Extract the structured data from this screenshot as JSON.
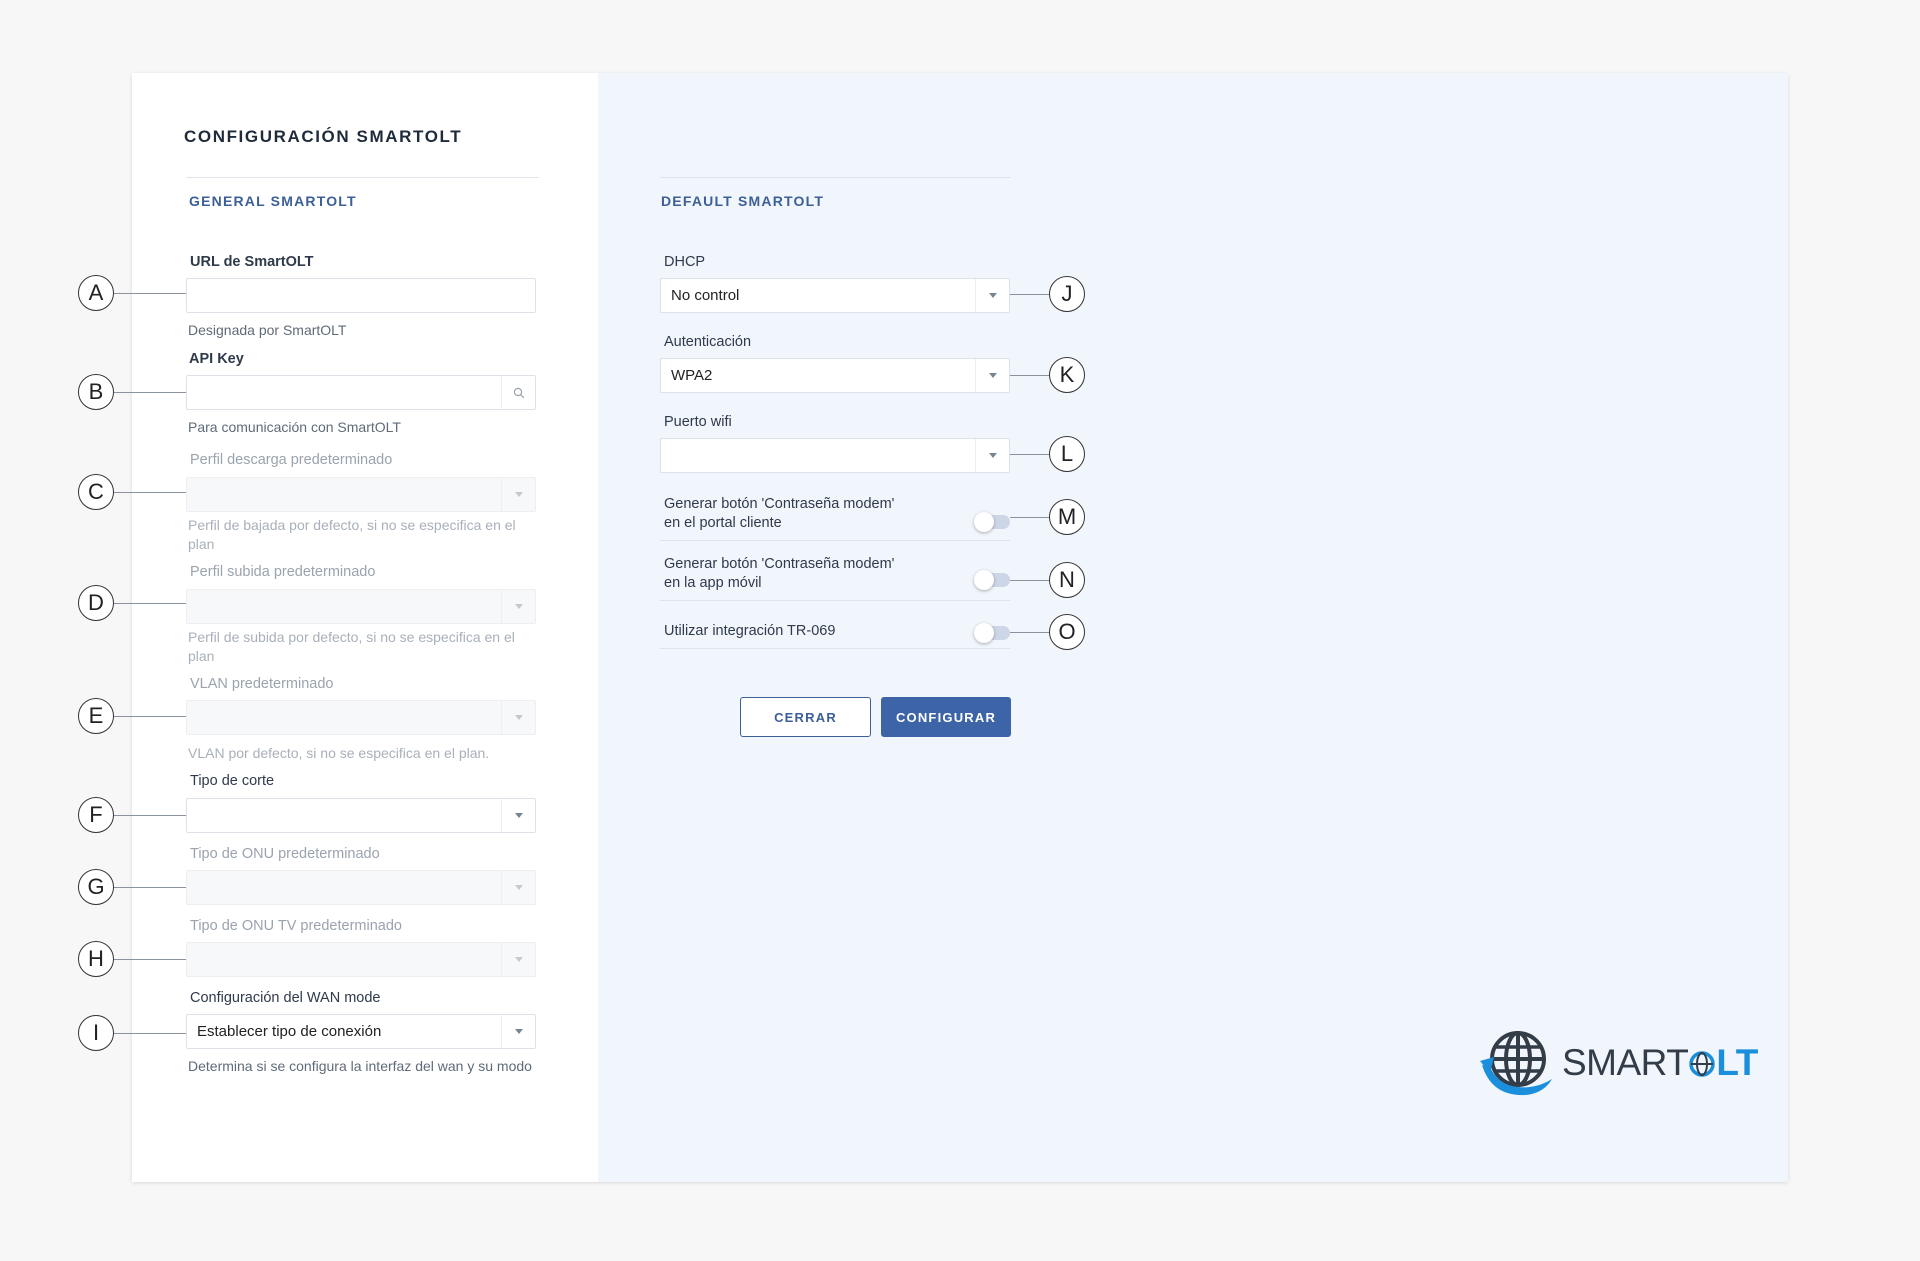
{
  "page": {
    "title": "CONFIGURACIÓN SMARTOLT"
  },
  "general": {
    "section_title": "GENERAL SMARTOLT",
    "url": {
      "label": "URL de SmartOLT",
      "value": "",
      "help": "Designada por SmartOLT"
    },
    "api_key": {
      "label": "API Key",
      "value": "",
      "help": "Para comunicación con SmartOLT"
    },
    "download_profile": {
      "label": "Perfil descarga predeterminado",
      "value": "",
      "help": "Perfil de bajada por defecto, si no se especifica en el plan"
    },
    "upload_profile": {
      "label": "Perfil subida predeterminado",
      "value": "",
      "help": "Perfil de subida por defecto, si no se especifica en el plan"
    },
    "vlan": {
      "label": "VLAN predeterminado",
      "value": "",
      "help": "VLAN por defecto, si no se especifica en el plan."
    },
    "cut_type": {
      "label": "Tipo de corte",
      "value": ""
    },
    "onu_type": {
      "label": "Tipo de ONU predeterminado",
      "value": ""
    },
    "onu_tv_type": {
      "label": "Tipo de ONU TV predeterminado",
      "value": ""
    },
    "wan_mode": {
      "label": "Configuración del WAN mode",
      "value": "Establecer tipo de conexión",
      "help": "Determina si se configura la interfaz del wan y su modo"
    }
  },
  "defaults": {
    "section_title": "DEFAULT SMARTOLT",
    "dhcp": {
      "label": "DHCP",
      "value": "No control"
    },
    "auth": {
      "label": "Autenticación",
      "value": "WPA2"
    },
    "wifi_port": {
      "label": "Puerto wifi",
      "value": ""
    },
    "toggles": [
      {
        "label_line1": "Generar botón 'Contraseña modem'",
        "label_line2": "en el portal cliente",
        "on": false
      },
      {
        "label_line1": "Generar botón 'Contraseña modem'",
        "label_line2": "en la app móvil",
        "on": false
      },
      {
        "label_line1": "Utilizar integración TR-069",
        "label_line2": "",
        "on": false
      }
    ]
  },
  "buttons": {
    "close_label": "CERRAR",
    "configure_label": "CONFIGURAR"
  },
  "markers": [
    "A",
    "B",
    "C",
    "D",
    "E",
    "F",
    "G",
    "H",
    "I",
    "J",
    "K",
    "L",
    "M",
    "N",
    "O"
  ],
  "logo": {
    "text_main": "SMART",
    "text_accent": "LT",
    "accent_color": "#1c8fdc"
  },
  "colors": {
    "primary": "#3d64a6",
    "section": "#3d5f97",
    "right_panel_bg": "#f1f5fc"
  }
}
